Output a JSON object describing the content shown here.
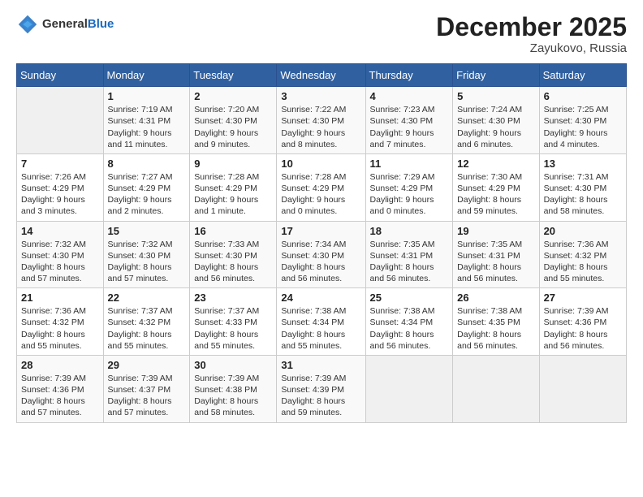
{
  "header": {
    "logo_general": "General",
    "logo_blue": "Blue",
    "month_year": "December 2025",
    "location": "Zayukovo, Russia"
  },
  "days_of_week": [
    "Sunday",
    "Monday",
    "Tuesday",
    "Wednesday",
    "Thursday",
    "Friday",
    "Saturday"
  ],
  "weeks": [
    [
      {
        "day": "",
        "info": ""
      },
      {
        "day": "1",
        "info": "Sunrise: 7:19 AM\nSunset: 4:31 PM\nDaylight: 9 hours\nand 11 minutes."
      },
      {
        "day": "2",
        "info": "Sunrise: 7:20 AM\nSunset: 4:30 PM\nDaylight: 9 hours\nand 9 minutes."
      },
      {
        "day": "3",
        "info": "Sunrise: 7:22 AM\nSunset: 4:30 PM\nDaylight: 9 hours\nand 8 minutes."
      },
      {
        "day": "4",
        "info": "Sunrise: 7:23 AM\nSunset: 4:30 PM\nDaylight: 9 hours\nand 7 minutes."
      },
      {
        "day": "5",
        "info": "Sunrise: 7:24 AM\nSunset: 4:30 PM\nDaylight: 9 hours\nand 6 minutes."
      },
      {
        "day": "6",
        "info": "Sunrise: 7:25 AM\nSunset: 4:30 PM\nDaylight: 9 hours\nand 4 minutes."
      }
    ],
    [
      {
        "day": "7",
        "info": "Sunrise: 7:26 AM\nSunset: 4:29 PM\nDaylight: 9 hours\nand 3 minutes."
      },
      {
        "day": "8",
        "info": "Sunrise: 7:27 AM\nSunset: 4:29 PM\nDaylight: 9 hours\nand 2 minutes."
      },
      {
        "day": "9",
        "info": "Sunrise: 7:28 AM\nSunset: 4:29 PM\nDaylight: 9 hours\nand 1 minute."
      },
      {
        "day": "10",
        "info": "Sunrise: 7:28 AM\nSunset: 4:29 PM\nDaylight: 9 hours\nand 0 minutes."
      },
      {
        "day": "11",
        "info": "Sunrise: 7:29 AM\nSunset: 4:29 PM\nDaylight: 9 hours\nand 0 minutes."
      },
      {
        "day": "12",
        "info": "Sunrise: 7:30 AM\nSunset: 4:29 PM\nDaylight: 8 hours\nand 59 minutes."
      },
      {
        "day": "13",
        "info": "Sunrise: 7:31 AM\nSunset: 4:30 PM\nDaylight: 8 hours\nand 58 minutes."
      }
    ],
    [
      {
        "day": "14",
        "info": "Sunrise: 7:32 AM\nSunset: 4:30 PM\nDaylight: 8 hours\nand 57 minutes."
      },
      {
        "day": "15",
        "info": "Sunrise: 7:32 AM\nSunset: 4:30 PM\nDaylight: 8 hours\nand 57 minutes."
      },
      {
        "day": "16",
        "info": "Sunrise: 7:33 AM\nSunset: 4:30 PM\nDaylight: 8 hours\nand 56 minutes."
      },
      {
        "day": "17",
        "info": "Sunrise: 7:34 AM\nSunset: 4:30 PM\nDaylight: 8 hours\nand 56 minutes."
      },
      {
        "day": "18",
        "info": "Sunrise: 7:35 AM\nSunset: 4:31 PM\nDaylight: 8 hours\nand 56 minutes."
      },
      {
        "day": "19",
        "info": "Sunrise: 7:35 AM\nSunset: 4:31 PM\nDaylight: 8 hours\nand 56 minutes."
      },
      {
        "day": "20",
        "info": "Sunrise: 7:36 AM\nSunset: 4:32 PM\nDaylight: 8 hours\nand 55 minutes."
      }
    ],
    [
      {
        "day": "21",
        "info": "Sunrise: 7:36 AM\nSunset: 4:32 PM\nDaylight: 8 hours\nand 55 minutes."
      },
      {
        "day": "22",
        "info": "Sunrise: 7:37 AM\nSunset: 4:32 PM\nDaylight: 8 hours\nand 55 minutes."
      },
      {
        "day": "23",
        "info": "Sunrise: 7:37 AM\nSunset: 4:33 PM\nDaylight: 8 hours\nand 55 minutes."
      },
      {
        "day": "24",
        "info": "Sunrise: 7:38 AM\nSunset: 4:34 PM\nDaylight: 8 hours\nand 55 minutes."
      },
      {
        "day": "25",
        "info": "Sunrise: 7:38 AM\nSunset: 4:34 PM\nDaylight: 8 hours\nand 56 minutes."
      },
      {
        "day": "26",
        "info": "Sunrise: 7:38 AM\nSunset: 4:35 PM\nDaylight: 8 hours\nand 56 minutes."
      },
      {
        "day": "27",
        "info": "Sunrise: 7:39 AM\nSunset: 4:36 PM\nDaylight: 8 hours\nand 56 minutes."
      }
    ],
    [
      {
        "day": "28",
        "info": "Sunrise: 7:39 AM\nSunset: 4:36 PM\nDaylight: 8 hours\nand 57 minutes."
      },
      {
        "day": "29",
        "info": "Sunrise: 7:39 AM\nSunset: 4:37 PM\nDaylight: 8 hours\nand 57 minutes."
      },
      {
        "day": "30",
        "info": "Sunrise: 7:39 AM\nSunset: 4:38 PM\nDaylight: 8 hours\nand 58 minutes."
      },
      {
        "day": "31",
        "info": "Sunrise: 7:39 AM\nSunset: 4:39 PM\nDaylight: 8 hours\nand 59 minutes."
      },
      {
        "day": "",
        "info": ""
      },
      {
        "day": "",
        "info": ""
      },
      {
        "day": "",
        "info": ""
      }
    ]
  ]
}
